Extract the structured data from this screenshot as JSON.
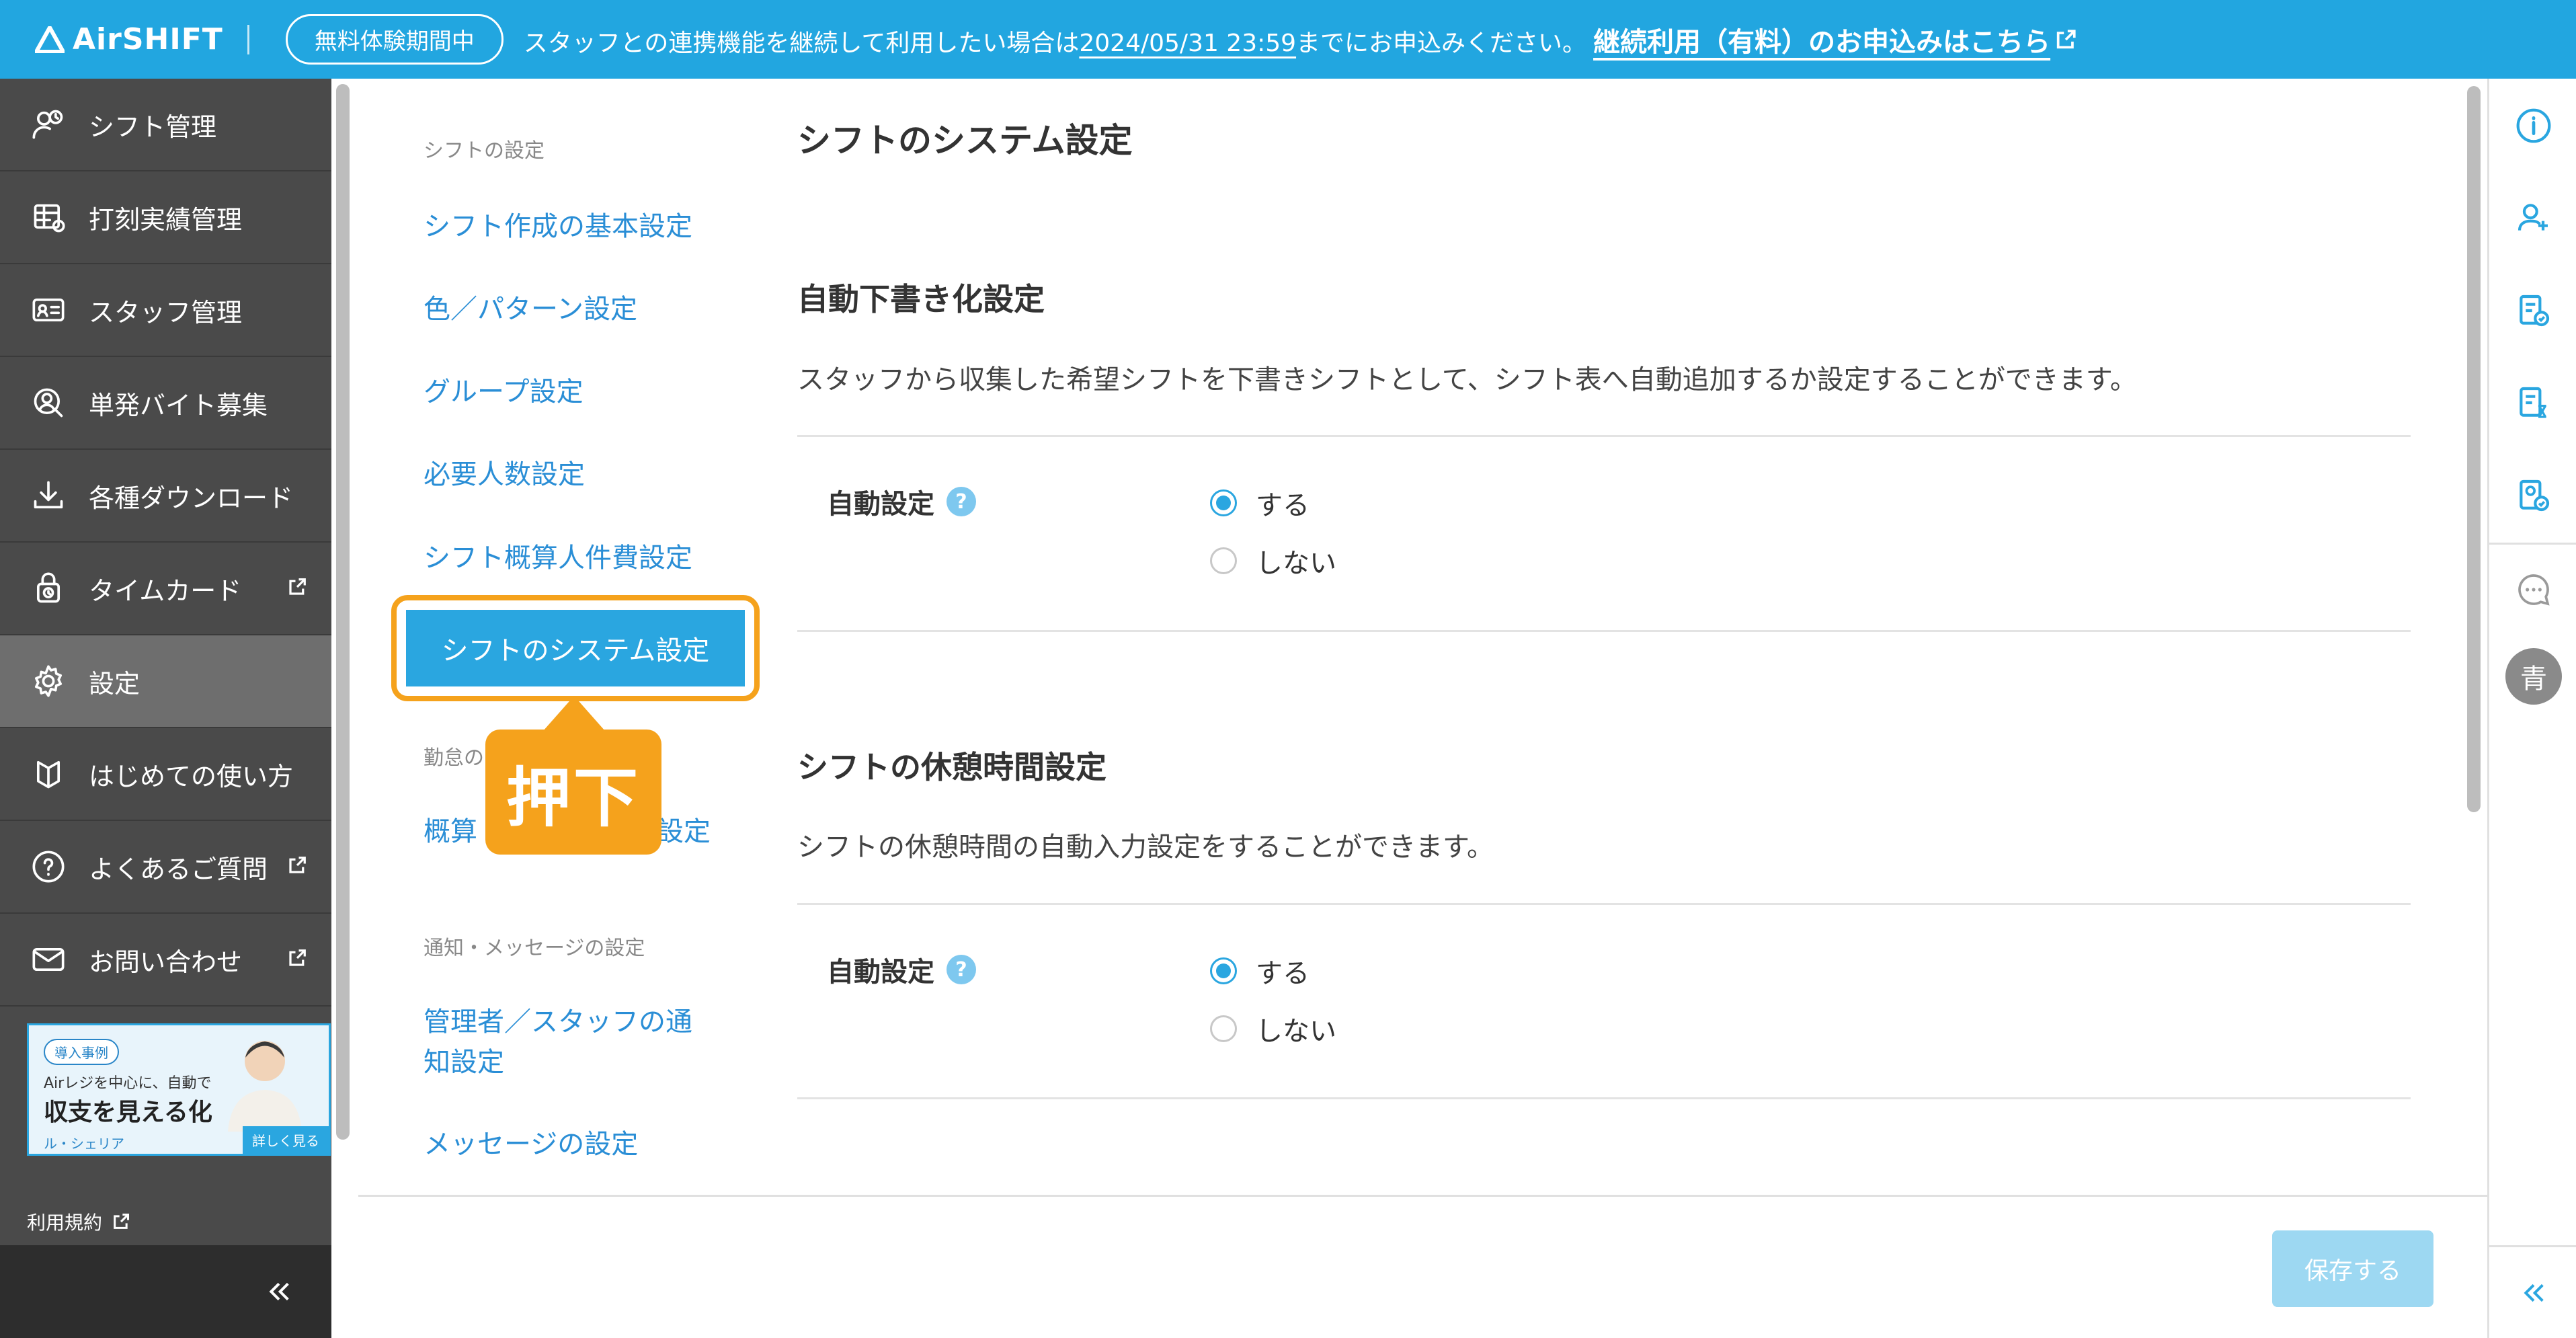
{
  "colors": {
    "brand": "#22a6e0",
    "highlight": "#f5a21c",
    "sidebar": "#4a4a4a",
    "link": "#2a8ed6"
  },
  "header": {
    "logo_text": "AirSHIFT",
    "trial_badge": "無料体験期間中",
    "notice_prefix": "スタッフとの連携機能を継続して利用したい場合は",
    "notice_date": "2024/05/31 23:59",
    "notice_suffix": "までにお申込みください。",
    "notice_link": "継続利用（有料）のお申込みはこちら"
  },
  "sidebar": {
    "items": [
      {
        "label": "シフト管理",
        "icon": "shift-icon"
      },
      {
        "label": "打刻実績管理",
        "icon": "timecard-table-icon"
      },
      {
        "label": "スタッフ管理",
        "icon": "staff-card-icon"
      },
      {
        "label": "単発バイト募集",
        "icon": "recruit-icon"
      },
      {
        "label": "各種ダウンロード",
        "icon": "download-icon"
      },
      {
        "label": "タイムカード",
        "icon": "lock-clock-icon",
        "external": true
      },
      {
        "label": "設定",
        "icon": "gear-icon",
        "active": true
      },
      {
        "label": "はじめての使い方",
        "icon": "beginner-icon"
      },
      {
        "label": "よくあるご質問",
        "icon": "question-icon",
        "external": true
      },
      {
        "label": "お問い合わせ",
        "icon": "mail-icon",
        "external": true
      }
    ],
    "promo": {
      "tag": "導入事例",
      "line1": "Airレジを中心に、自動で",
      "line2": "収支を見える化",
      "line3": "ル・シェリア",
      "more": "詳しく見る"
    },
    "terms": "利用規約"
  },
  "subnav": {
    "section1": "シフトの設定",
    "links1": [
      "シフト作成の基本設定",
      "色／パターン設定",
      "グループ設定",
      "必要人数設定",
      "シフト概算人件費設定"
    ],
    "selected": "シフトのシステム設定",
    "section2": "勤怠の",
    "link2": "概算",
    "link2_tail": "設定",
    "section3": "通知・メッセージの設定",
    "link3_line1": "管理者／スタッフの通",
    "link3_line2": "知設定",
    "link4": "メッセージの設定"
  },
  "callout": "押下",
  "main": {
    "title": "シフトのシステム設定",
    "blocks": [
      {
        "title": "自動下書き化設定",
        "desc": "スタッフから収集した希望シフトを下書きシフトとして、シフト表へ自動追加するか設定することができます。",
        "label": "自動設定",
        "options": [
          "する",
          "しない"
        ],
        "selected": "する"
      },
      {
        "title": "シフトの休憩時間設定",
        "desc": "シフトの休憩時間の自動入力設定をすることができます。",
        "label": "自動設定",
        "options": [
          "する",
          "しない"
        ],
        "selected": "する"
      }
    ]
  },
  "footer": {
    "save_label": "保存する"
  },
  "rail": {
    "avatar_text": "青"
  }
}
